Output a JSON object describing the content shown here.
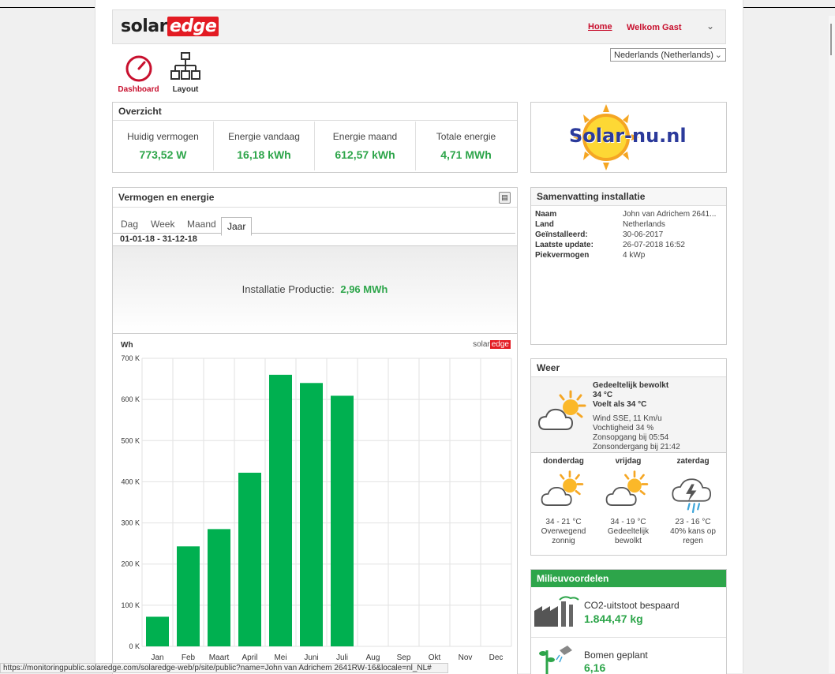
{
  "header": {
    "logo_solar": "solar",
    "logo_edge": "edge",
    "home_label": "Home",
    "welcome_label": "Welkom Gast",
    "language": "Nederlands (Netherlands)"
  },
  "nav": {
    "dashboard_label": "Dashboard",
    "layout_label": "Layout"
  },
  "overview": {
    "title": "Overzicht",
    "cells": [
      {
        "label": "Huidig vermogen",
        "value": "773,52 W"
      },
      {
        "label": "Energie vandaag",
        "value": "16,18 kWh"
      },
      {
        "label": "Energie maand",
        "value": "612,57 kWh"
      },
      {
        "label": "Totale energie",
        "value": "4,71 MWh"
      }
    ]
  },
  "brand_banner": {
    "text": "Solar-nu.nl"
  },
  "energy": {
    "title": "Vermogen en energie",
    "tabs": [
      "Dag",
      "Week",
      "Maand",
      "Jaar"
    ],
    "active_tab": "Jaar",
    "date_range": "01-01-18 - 31-12-18",
    "production_label": "Installatie Productie:",
    "production_value": "2,96 MWh",
    "watermark_solar": "solar",
    "watermark_edge": "edge"
  },
  "chart_data": {
    "type": "bar",
    "ylabel": "Wh",
    "ylim": [
      0,
      700
    ],
    "yticks": [
      "0 K",
      "100 K",
      "200 K",
      "300 K",
      "400 K",
      "500 K",
      "600 K",
      "700 K"
    ],
    "categories": [
      "Jan",
      "Feb",
      "Maart",
      "April",
      "Mei",
      "Juni",
      "Juli",
      "Aug",
      "Sep",
      "Okt",
      "Nov",
      "Dec"
    ],
    "values": [
      72,
      243,
      285,
      422,
      660,
      640,
      609,
      0,
      0,
      0,
      0,
      0
    ],
    "bar_color": "#00b050",
    "grid": true
  },
  "summary": {
    "title": "Samenvatting installatie",
    "rows": [
      {
        "key": "Naam",
        "value": "John van Adrichem 2641..."
      },
      {
        "key": "Land",
        "value": "Netherlands"
      },
      {
        "key": "Geïnstalleerd:",
        "value": "30-06-2017"
      },
      {
        "key": "Laatste update:",
        "value": "26-07-2018 16:52"
      },
      {
        "key": "Piekvermogen",
        "value": "4 kWp"
      }
    ]
  },
  "weather": {
    "title": "Weer",
    "current": {
      "condition": "Gedeeltelijk bewolkt",
      "temp": "34 °C",
      "feels": "Voelt als 34 °C",
      "wind": "Wind SSE, 11 Km/u",
      "humidity": "Vochtigheid 34 %",
      "sunrise": "Zonsopgang bij 05:54",
      "sunset": "Zonsondergang bij 21:42"
    },
    "forecast": [
      {
        "day": "donderdag",
        "temp": "34 - 21 °C",
        "desc1": "Overwegend",
        "desc2": "zonnig",
        "icon": "sun-cloud-icon"
      },
      {
        "day": "vrijdag",
        "temp": "34 - 19 °C",
        "desc1": "Gedeeltelijk",
        "desc2": "bewolkt",
        "icon": "sun-cloud-icon"
      },
      {
        "day": "zaterdag",
        "temp": "23 - 16 °C",
        "desc1": "40% kans op",
        "desc2": "regen",
        "icon": "storm-icon"
      }
    ]
  },
  "environment": {
    "title": "Milieuvoordelen",
    "co2_label": "CO2-uitstoot bespaard",
    "co2_value": "1.844,47 kg",
    "trees_label": "Bomen geplant",
    "trees_value": "6,16"
  },
  "statusbar": {
    "url": "https://monitoringpublic.solaredge.com/solaredge-web/p/site/public?name=John van Adrichem 2641RW-16&locale=nl_NL#"
  },
  "colors": {
    "accent_red": "#e31b23",
    "value_green": "#2da54a",
    "bar_green": "#00b050"
  }
}
